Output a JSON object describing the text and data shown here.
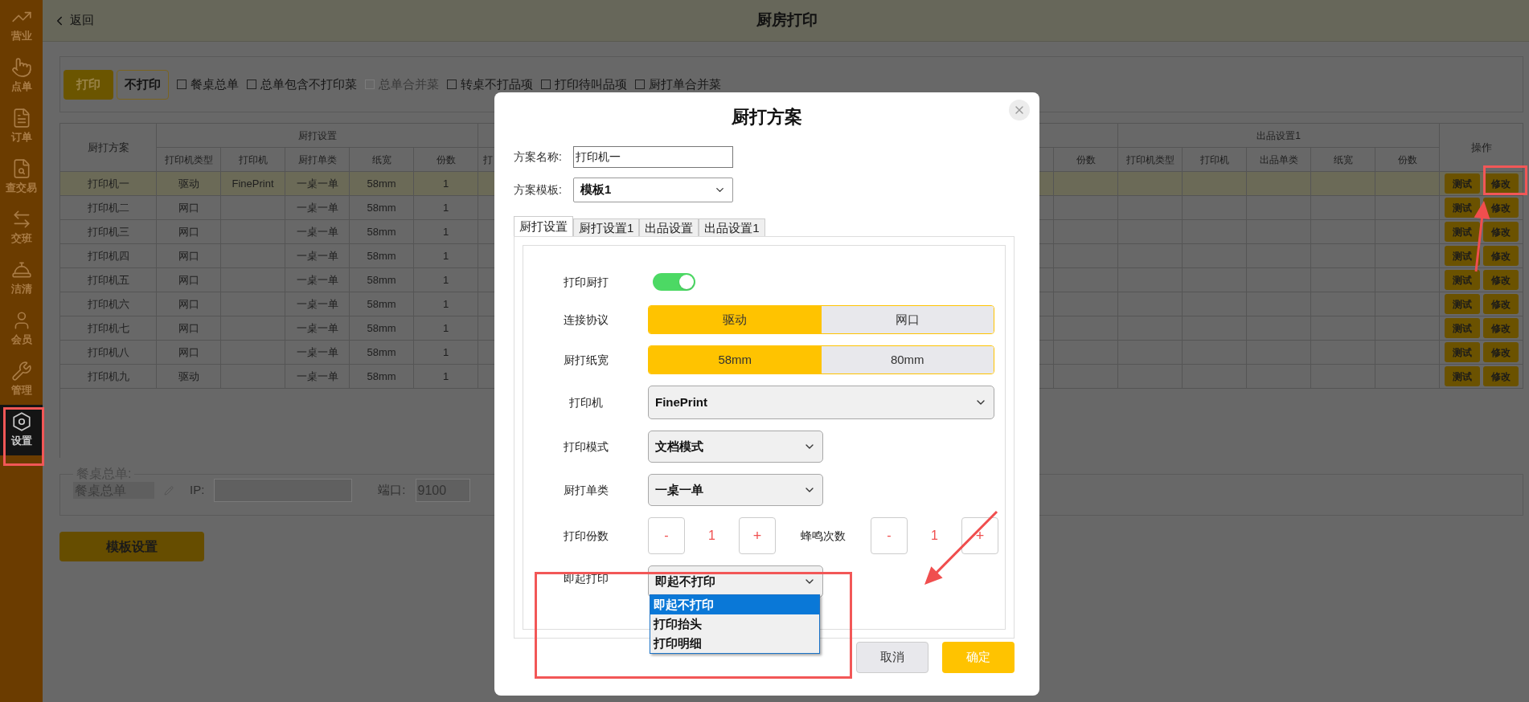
{
  "sidebar": {
    "items": [
      {
        "label": "营业",
        "selected": false
      },
      {
        "label": "点单",
        "selected": false
      },
      {
        "label": "订单",
        "selected": false
      },
      {
        "label": "查交易",
        "selected": false
      },
      {
        "label": "交班",
        "selected": false
      },
      {
        "label": "洁清",
        "selected": false
      },
      {
        "label": "会员",
        "selected": false
      },
      {
        "label": "管理",
        "selected": false
      },
      {
        "label": "设置",
        "selected": true
      }
    ]
  },
  "header": {
    "back": "返回",
    "title": "厨房打印"
  },
  "toolbar": {
    "modes": [
      {
        "label": "打印",
        "selected": true
      },
      {
        "label": "不打印",
        "selected": false
      }
    ],
    "options": [
      {
        "label": "餐桌总单",
        "checked": false,
        "disabled": false
      },
      {
        "label": "总单包含不打印菜",
        "checked": false,
        "disabled": false
      },
      {
        "label": "总单合并菜",
        "checked": false,
        "disabled": true
      },
      {
        "label": "转桌不打品项",
        "checked": false,
        "disabled": false
      },
      {
        "label": "打印待叫品项",
        "checked": false,
        "disabled": false
      },
      {
        "label": "厨打单合并菜",
        "checked": false,
        "disabled": false
      }
    ]
  },
  "table": {
    "first_column": "厨打方案",
    "groups": [
      {
        "title": "厨打设置",
        "columns": [
          "打印机类型",
          "打印机",
          "厨打单类",
          "纸宽",
          "份数"
        ]
      },
      {
        "title": "出品设置1",
        "columns": [
          "打印机类型",
          "打印机",
          "出品单类",
          "纸宽",
          "份数"
        ]
      }
    ],
    "column_7": "打",
    "column_8": "份数",
    "actions_column": "操作",
    "rows": [
      {
        "cells": [
          "打印机一",
          "驱动",
          "FinePrint",
          "一桌一单",
          "58mm",
          "1"
        ],
        "selected": true,
        "actions": [
          "测试",
          "修改"
        ]
      },
      {
        "cells": [
          "打印机二",
          "网口",
          "",
          "一桌一单",
          "58mm",
          "1"
        ],
        "selected": false,
        "actions": [
          "测试",
          "修改"
        ]
      },
      {
        "cells": [
          "打印机三",
          "网口",
          "",
          "一桌一单",
          "58mm",
          "1"
        ],
        "selected": false,
        "actions": [
          "测试",
          "修改"
        ]
      },
      {
        "cells": [
          "打印机四",
          "网口",
          "",
          "一桌一单",
          "58mm",
          "1"
        ],
        "selected": false,
        "actions": [
          "测试",
          "修改"
        ]
      },
      {
        "cells": [
          "打印机五",
          "网口",
          "",
          "一桌一单",
          "58mm",
          "1"
        ],
        "selected": false,
        "actions": [
          "测试",
          "修改"
        ]
      },
      {
        "cells": [
          "打印机六",
          "网口",
          "",
          "一桌一单",
          "58mm",
          "1"
        ],
        "selected": false,
        "actions": [
          "测试",
          "修改"
        ]
      },
      {
        "cells": [
          "打印机七",
          "网口",
          "",
          "一桌一单",
          "58mm",
          "1"
        ],
        "selected": false,
        "actions": [
          "测试",
          "修改"
        ]
      },
      {
        "cells": [
          "打印机八",
          "网口",
          "",
          "一桌一单",
          "58mm",
          "1"
        ],
        "selected": false,
        "actions": [
          "测试",
          "修改"
        ]
      },
      {
        "cells": [
          "打印机九",
          "驱动",
          "",
          "一桌一单",
          "58mm",
          "1"
        ],
        "selected": false,
        "actions": [
          "测试",
          "修改"
        ]
      }
    ]
  },
  "summary": {
    "legend": "餐桌总单:",
    "name": "餐桌总单",
    "ip_label": "IP:",
    "port_label": "端口:",
    "port": "9100"
  },
  "template_button": "模板设置",
  "dialog": {
    "title": "厨打方案",
    "name_label": "方案名称:",
    "name_value": "打印机一",
    "template_label": "方案模板:",
    "template_value": "模板1",
    "tabs": [
      {
        "label": "厨打设置",
        "selected": true
      },
      {
        "label": "厨打设置1",
        "selected": false
      },
      {
        "label": "出品设置",
        "selected": false
      },
      {
        "label": "出品设置1",
        "selected": false
      }
    ],
    "settings": [
      {
        "kind": "toggle",
        "label": "打印厨打",
        "on": true
      },
      {
        "kind": "segmented",
        "label": "连接协议",
        "options": [
          {
            "label": "驱动",
            "selected": true
          },
          {
            "label": "网口",
            "selected": false
          }
        ]
      },
      {
        "kind": "segmented",
        "label": "厨打纸宽",
        "options": [
          {
            "label": "58mm",
            "selected": true
          },
          {
            "label": "80mm",
            "selected": false
          }
        ]
      },
      {
        "kind": "wide-select",
        "label": "打印机",
        "value": "FinePrint"
      },
      {
        "kind": "select",
        "label": "打印模式",
        "value": "文档模式"
      },
      {
        "kind": "select",
        "label": "厨打单类",
        "value": "一桌一单"
      },
      {
        "kind": "steppers",
        "items": [
          {
            "label": "打印份数",
            "minus": "-",
            "value": "1",
            "plus": "+"
          },
          {
            "label": "蜂鸣次数",
            "minus": "-",
            "value": "1",
            "plus": "+"
          }
        ]
      },
      {
        "kind": "select",
        "label": "即起打印",
        "value": "即起不打印",
        "expanded": true,
        "options": [
          {
            "label": "即起不打印",
            "selected": true
          },
          {
            "label": "打印抬头",
            "selected": false
          },
          {
            "label": "打印明细",
            "selected": false
          }
        ]
      }
    ],
    "buttons": [
      {
        "label": "取消",
        "kind": "secondary"
      },
      {
        "label": "确定",
        "kind": "primary"
      }
    ]
  }
}
